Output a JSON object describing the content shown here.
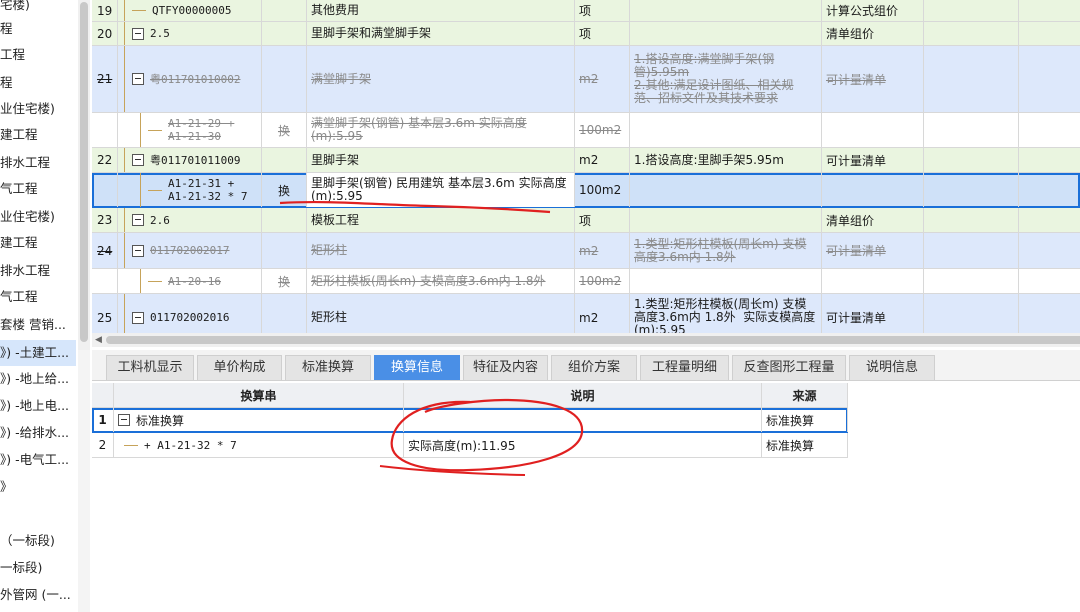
{
  "sidebar": {
    "items": [
      {
        "label": "宅楼)",
        "selected": false
      },
      {
        "label": "程",
        "selected": false
      },
      {
        "label": "工程",
        "selected": false
      },
      {
        "label": "程",
        "selected": false
      },
      {
        "label": "业住宅楼)",
        "selected": false
      },
      {
        "label": "建工程",
        "selected": false
      },
      {
        "label": "排水工程",
        "selected": false
      },
      {
        "label": "气工程",
        "selected": false
      },
      {
        "label": "业住宅楼)",
        "selected": false
      },
      {
        "label": "建工程",
        "selected": false
      },
      {
        "label": "排水工程",
        "selected": false
      },
      {
        "label": "气工程",
        "selected": false
      },
      {
        "label": "套楼 营销...",
        "selected": false
      },
      {
        "label": "》) -土建工...",
        "selected": true
      },
      {
        "label": "》) -地上给...",
        "selected": false
      },
      {
        "label": "》) -地上电...",
        "selected": false
      },
      {
        "label": "》) -给排水...",
        "selected": false
      },
      {
        "label": "》) -电气工...",
        "selected": false
      },
      {
        "label": "》",
        "selected": false
      },
      {
        "label": "",
        "selected": false
      },
      {
        "label": "（一标段)",
        "selected": false
      },
      {
        "label": "一标段)",
        "selected": false
      },
      {
        "label": "外管网 (一...",
        "selected": false
      }
    ]
  },
  "grid": {
    "rows": [
      {
        "num": "19",
        "code": "QTFY00000005",
        "conv": "",
        "name": "其他费用",
        "unit": "项",
        "feat": "",
        "bill": "计算公式组价",
        "style": "green",
        "strike": false
      },
      {
        "num": "20",
        "code": "2.5",
        "conv": "",
        "name": "里脚手架和满堂脚手架",
        "unit": "项",
        "feat": "",
        "bill": "清单组价",
        "style": "green",
        "strike": false
      },
      {
        "num": "21",
        "code": "粤011701010002",
        "conv": "",
        "name": "满堂脚手架",
        "unit": "m2",
        "feat": "1.搭设高度:满堂脚手架(钢管)5.95m\n2.其他:满足设计图纸、相关规范、招标文件及其技术要求",
        "bill": "可计量清单",
        "style": "blue",
        "strike": true
      },
      {
        "num": "",
        "code": "A1-21-29 + A1-21-30",
        "conv": "换",
        "name": "满堂脚手架(钢管) 基本层3.6m  实际高度(m):5.95",
        "unit": "100m2",
        "feat": "",
        "bill": "",
        "style": "white",
        "strike": true
      },
      {
        "num": "22",
        "code": "粤011701011009",
        "conv": "",
        "name": "里脚手架",
        "unit": "m2",
        "feat": "1.搭设高度:里脚手架5.95m",
        "bill": "可计量清单",
        "style": "green",
        "strike": false
      },
      {
        "num": "",
        "code": "A1-21-31 + A1-21-32 * 7",
        "conv": "换",
        "name": "里脚手架(钢管) 民用建筑 基本层3.6m  实际高度(m):5.95",
        "unit": "100m2",
        "feat": "",
        "bill": "",
        "style": "selected",
        "strike": false
      },
      {
        "num": "23",
        "code": "2.6",
        "conv": "",
        "name": "模板工程",
        "unit": "项",
        "feat": "",
        "bill": "清单组价",
        "style": "green",
        "strike": false
      },
      {
        "num": "24",
        "code": "011702002017",
        "conv": "",
        "name": "矩形柱",
        "unit": "m2",
        "feat": "1.类型:矩形柱模板(周长m) 支模高度3.6m内 1.8外",
        "bill": "可计量清单",
        "style": "blue",
        "strike": true
      },
      {
        "num": "",
        "code": "A1-20-16",
        "conv": "换",
        "name": "矩形柱模板(周长m) 支模高度3.6m内 1.8外",
        "unit": "100m2",
        "feat": "",
        "bill": "",
        "style": "white",
        "strike": true
      },
      {
        "num": "25",
        "code": "011702002016",
        "conv": "",
        "name": "矩形柱",
        "unit": "m2",
        "feat": "1.类型:矩形柱模板(周长m) 支模高度3.6m内 1.8外  实际支模高度(m):5.95",
        "bill": "可计量清单",
        "style": "blue",
        "strike": false
      }
    ]
  },
  "tabs": [
    {
      "label": "工料机显示",
      "active": false
    },
    {
      "label": "单价构成",
      "active": false
    },
    {
      "label": "标准换算",
      "active": false
    },
    {
      "label": "换算信息",
      "active": true
    },
    {
      "label": "特征及内容",
      "active": false
    },
    {
      "label": "组价方案",
      "active": false
    },
    {
      "label": "工程量明细",
      "active": false
    },
    {
      "label": "反查图形工程量",
      "active": false
    },
    {
      "label": "说明信息",
      "active": false
    }
  ],
  "conv_table": {
    "headers": {
      "string": "换算串",
      "desc": "说明",
      "source": "来源"
    },
    "rows": [
      {
        "idx": "1",
        "string": "标准换算",
        "desc": "",
        "source": "标准换算"
      },
      {
        "idx": "2",
        "string": "+ A1-21-32 * 7",
        "desc": "实际高度(m):11.95",
        "source": "标准换算"
      }
    ]
  },
  "colors": {
    "annotation": "#e02020",
    "active_tab": "#4a8fe6",
    "selection": "#1a6fd8"
  }
}
